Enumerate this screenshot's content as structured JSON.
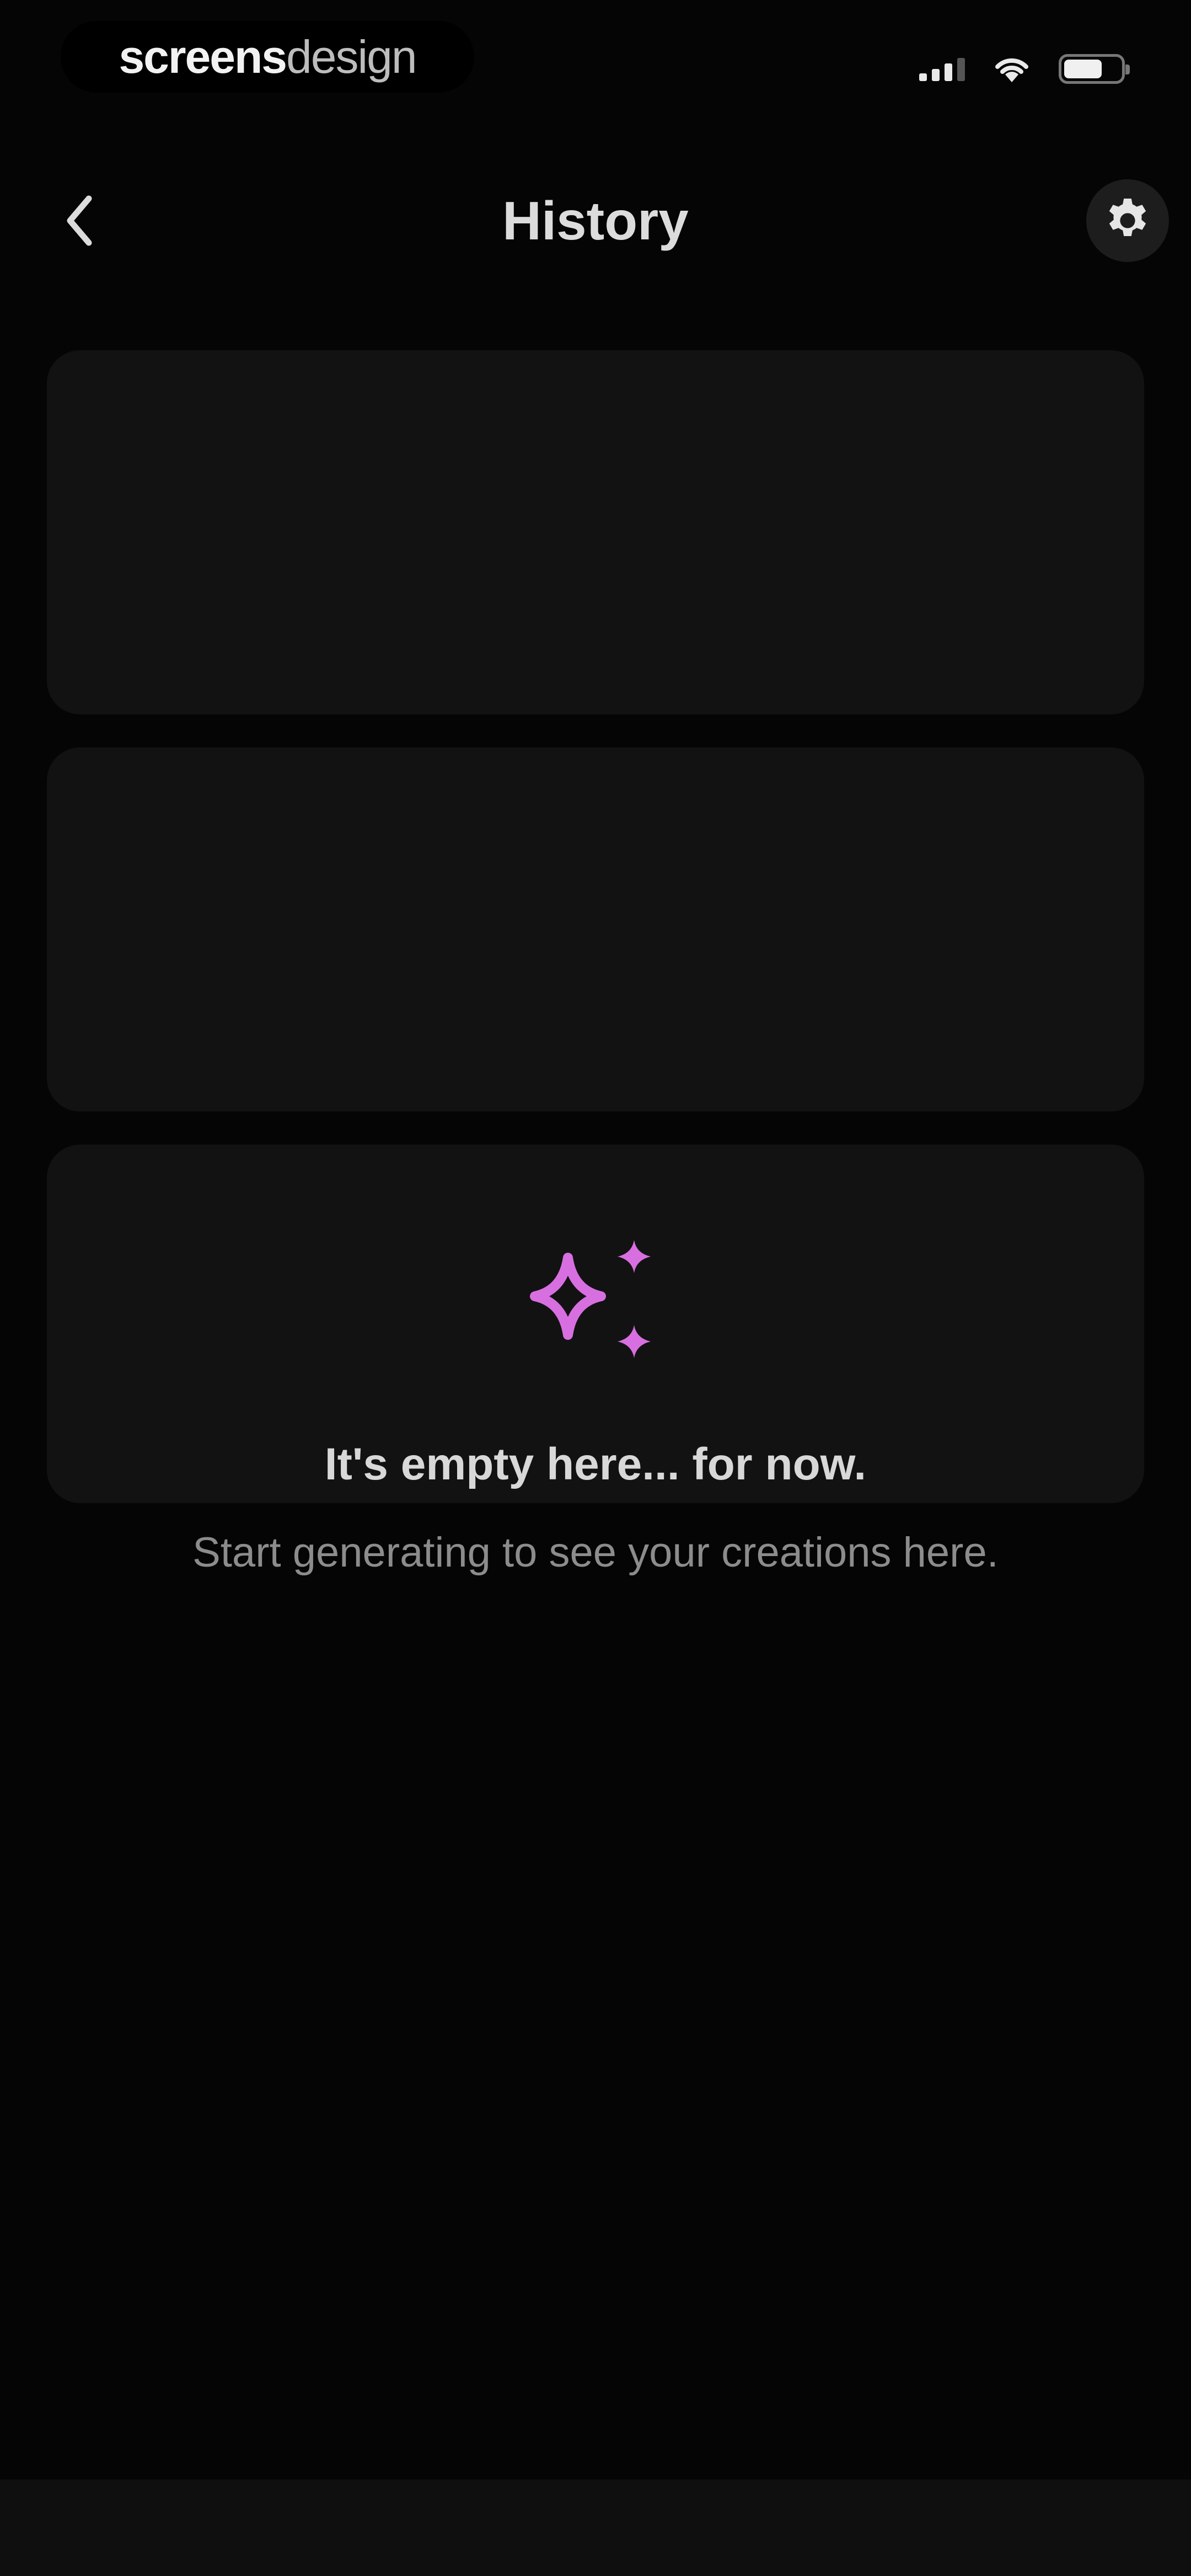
{
  "status_bar": {
    "brand_strong": "screens",
    "brand_light": "design",
    "icons": [
      "signal-icon",
      "wifi-icon",
      "battery-icon"
    ]
  },
  "header": {
    "title": "History",
    "back_icon": "chevron-left-icon",
    "settings_icon": "gear-icon"
  },
  "empty_state": {
    "icon": "sparkles-icon",
    "title": "It's empty here... for now.",
    "subtitle": "Start generating to see your creations here."
  },
  "colors": {
    "background": "#050505",
    "card": "#121212",
    "accent": "#d86fe0",
    "text_primary": "#dcdcdc",
    "text_secondary": "#8c8c8c"
  }
}
